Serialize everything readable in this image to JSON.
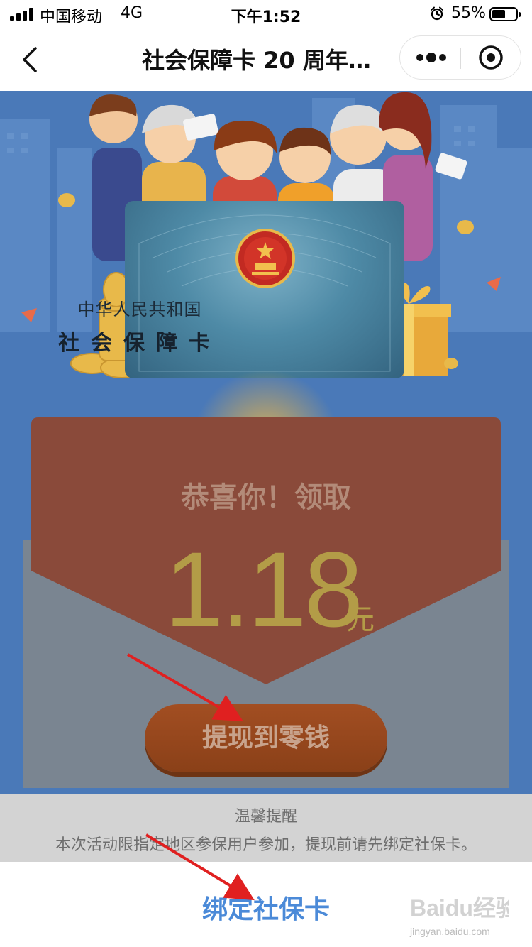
{
  "status_bar": {
    "carrier": "中国移动",
    "network": "4G",
    "time": "下午1:52",
    "battery_percent": "55%",
    "battery_level": 0.55,
    "icons": [
      "signal-icon",
      "alarm-icon",
      "battery-icon"
    ]
  },
  "nav": {
    "title": "社会保障卡 20 周年…",
    "icons": [
      "back-arrow-icon",
      "more-dots-icon",
      "close-target-icon"
    ]
  },
  "card": {
    "country": "中华人民共和国",
    "name": "社会保障卡"
  },
  "envelope": {
    "congrats": "恭喜你！领取",
    "amount": "1.18",
    "unit": "元",
    "withdraw_label": "提现到零钱"
  },
  "reminder": {
    "title": "温馨提醒",
    "text": "本次活动限指定地区参保用户参加，提现前请先绑定社保卡。"
  },
  "bind_card": {
    "label": "绑定社保卡"
  },
  "watermark": {
    "logo": "Baidu经验",
    "url": "jingyan.baidu.com"
  },
  "colors": {
    "scene_bg": "#4a79b8",
    "envelope_red": "#8a4a3a",
    "amount_gold": "#b39c47",
    "link_blue": "#4b8ad8",
    "arrow_red": "#e02020"
  }
}
